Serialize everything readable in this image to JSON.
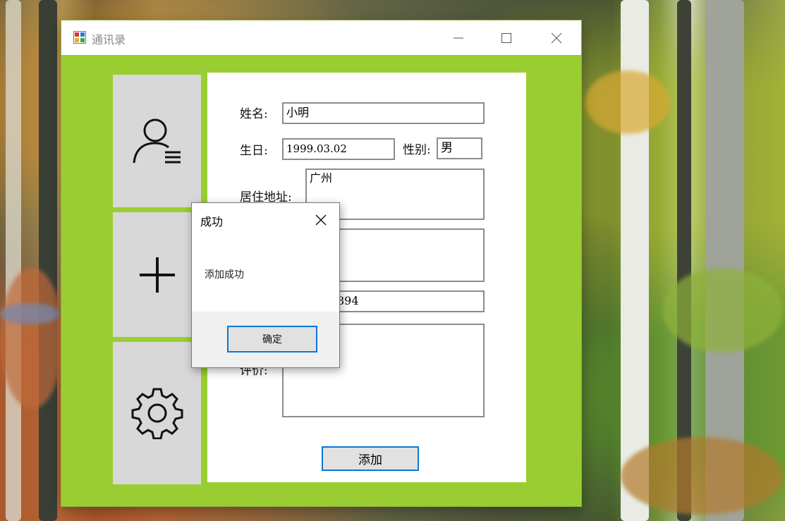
{
  "window": {
    "title": "通讯录",
    "minimize_glyph": "—",
    "maximize_glyph": "☐",
    "close_glyph": "✕"
  },
  "sidebar": {
    "items": [
      {
        "icon": "user-list-icon"
      },
      {
        "icon": "plus-icon"
      },
      {
        "icon": "gear-icon"
      }
    ]
  },
  "form": {
    "name_label": "姓名:",
    "name_value": "小明",
    "birthday_label": "生日:",
    "birthday_value": "1999.03.02",
    "gender_label": "性别:",
    "gender_value": "男",
    "address_label": "居住地址:",
    "address_value": "广州",
    "phone_value_partial": "894",
    "remark_label_partial": "评价:",
    "add_button": "添加"
  },
  "dialog": {
    "title": "成功",
    "message": "添加成功",
    "ok_button": "确定"
  },
  "colors": {
    "accent": "#9acd32",
    "button_border": "#0a78d7",
    "sidebar_bg": "#d8d8d8"
  }
}
